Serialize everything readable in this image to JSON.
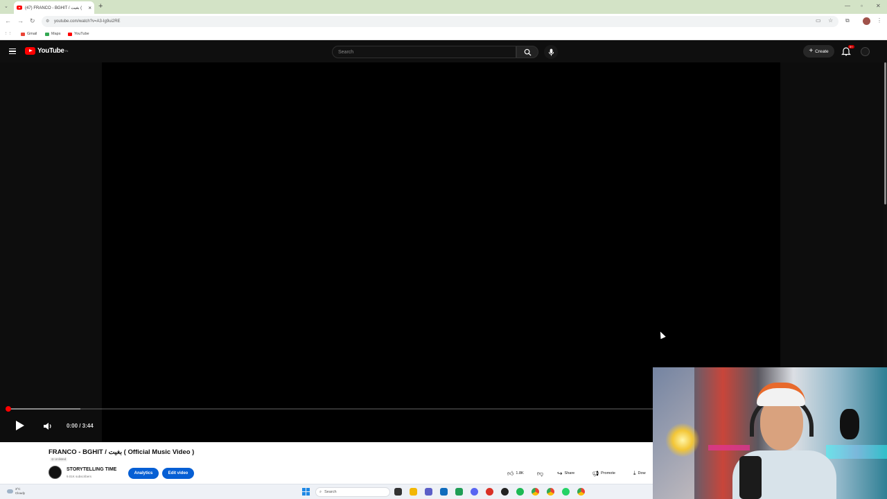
{
  "browser": {
    "tab_title": "(47) FRANCO - BGHIT / بغيت (",
    "url": "youtube.com/watch?v=A3-Ig9ui2RE",
    "bookmarks": [
      "Gmail",
      "Maps",
      "YouTube"
    ]
  },
  "masthead": {
    "logo_text": "YouTube",
    "logo_badge": "TN",
    "search_placeholder": "Search",
    "create_label": "Create",
    "notification_count": "9+"
  },
  "player": {
    "time": "0:00 / 3:44",
    "progress_fraction": 0.0,
    "buffered_fraction": 0.083
  },
  "video": {
    "title": "FRANCO - BGHIT / بغيت ( Official Music Video )",
    "visibility": "Unlisted",
    "channel_name": "STORYTELLING TIME",
    "subscribers": "9.01K subscribers",
    "analytics_label": "Analytics",
    "edit_label": "Edit video",
    "likes": "1.8K",
    "share_label": "Share",
    "promote_label": "Promote",
    "download_label": "Dow"
  },
  "taskbar": {
    "temperature": "3°C",
    "weather": "Cloudy",
    "search_label": "Search"
  },
  "colors": {
    "yt_red": "#ff0000",
    "accent_blue": "#065fd4",
    "dark_bg": "#0f0f0f"
  }
}
